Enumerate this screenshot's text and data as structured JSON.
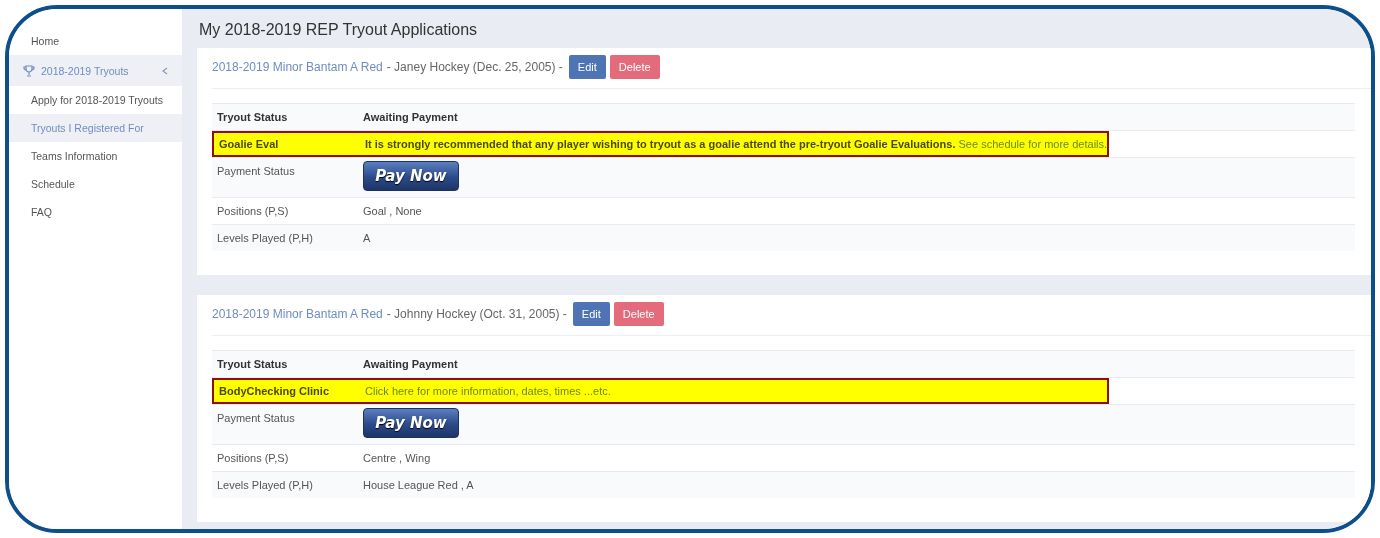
{
  "sidebar": {
    "items": [
      {
        "label": "Home",
        "selected": false
      },
      {
        "label": "2018-2019 Tryouts",
        "selected": true,
        "expanded": true,
        "children": [
          {
            "label": "Apply for 2018-2019 Tryouts",
            "selected": false
          },
          {
            "label": "Tryouts I Registered For",
            "selected": true
          },
          {
            "label": "Teams Information",
            "selected": false
          },
          {
            "label": "Schedule",
            "selected": false
          },
          {
            "label": "FAQ",
            "selected": false
          }
        ]
      }
    ]
  },
  "page_title": "My 2018-2019 REP Tryout Applications",
  "applications": [
    {
      "division": "2018-2019 Minor Bantam A Red",
      "player": "- Janey Hockey (Dec. 25, 2005) -",
      "buttons": [
        "Edit",
        "Delete"
      ],
      "rows": [
        {
          "kind": "header",
          "label": "Tryout Status",
          "value": "Awaiting Payment"
        },
        {
          "kind": "alert",
          "label": "Goalie Eval",
          "value": "It is strongly recommended that any player wishing to tryout as a goalie attend the pre-tryout Goalie Evaluations.",
          "link": "See schedule for more details."
        },
        {
          "kind": "payment",
          "label": "Payment Status",
          "button": "Pay Now"
        },
        {
          "kind": "plain",
          "label": "Positions (P,S)",
          "value": "Goal , None"
        },
        {
          "kind": "plain",
          "label": "Levels Played (P,H)",
          "value": "A"
        }
      ]
    },
    {
      "division": "2018-2019 Minor Bantam A Red",
      "player": "- Johnny Hockey (Oct. 31, 2005) -",
      "buttons": [
        "Edit",
        "Delete"
      ],
      "rows": [
        {
          "kind": "header",
          "label": "Tryout Status",
          "value": "Awaiting Payment"
        },
        {
          "kind": "alert",
          "label": "BodyChecking Clinic",
          "link": "Click here for more information, dates, times ...etc."
        },
        {
          "kind": "payment",
          "label": "Payment Status",
          "button": "Pay Now"
        },
        {
          "kind": "plain",
          "label": "Positions (P,S)",
          "value": "Centre , Wing"
        },
        {
          "kind": "plain",
          "label": "Levels Played (P,H)",
          "value": "House League Red , A"
        }
      ]
    }
  ]
}
